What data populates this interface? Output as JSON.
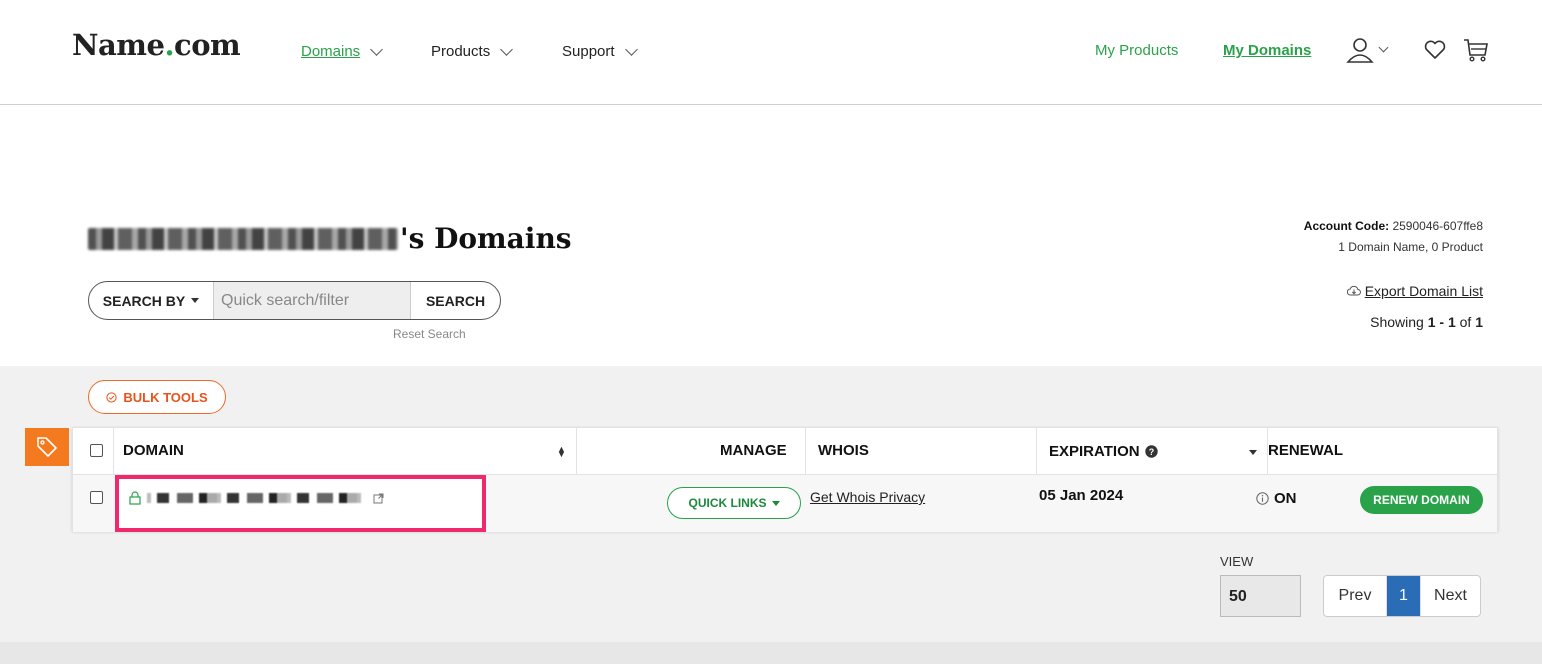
{
  "nav": {
    "logo_name": "Name",
    "logo_dot": ".",
    "logo_tld": "com",
    "items": [
      {
        "label": "Domains"
      },
      {
        "label": "Products"
      },
      {
        "label": "Support"
      }
    ],
    "my_products": "My Products",
    "my_domains": "My Domains",
    "icons": [
      "user-icon",
      "heart-icon",
      "cart-icon"
    ]
  },
  "header": {
    "title_suffix": "'s Domains",
    "account_code_label": "Account Code:",
    "account_code_value": " 2590046-607ffe8",
    "account_summary": "1 Domain Name, 0 Product",
    "export_label": "Export Domain List",
    "showing_prefix": "Showing ",
    "showing_range": "1 - 1",
    "showing_of": " of ",
    "showing_total": "1"
  },
  "search": {
    "search_by_label": "SEARCH BY",
    "placeholder": "Quick search/filter",
    "button_label": "SEARCH",
    "reset_label": "Reset Search"
  },
  "bulk_tools_label": "BULK TOOLS",
  "table": {
    "columns": {
      "domain": "DOMAIN",
      "manage": "MANAGE",
      "whois": "WHOIS",
      "expiration": "EXPIRATION",
      "renewal": "RENEWAL"
    },
    "rows": [
      {
        "quick_links": "QUICK LINKS",
        "whois_link": "Get Whois Privacy",
        "expiration": "05 Jan 2024",
        "renewal_status": "ON",
        "renew_button": "RENEW DOMAIN"
      }
    ]
  },
  "pagination": {
    "view_label": "VIEW",
    "view_value": "50",
    "prev": "Prev",
    "current": "1",
    "next": "Next"
  },
  "colors": {
    "brand_green": "#2aa24a",
    "accent_orange": "#f47a20",
    "highlight_pink": "#f0296d",
    "pager_blue": "#2a6cb5"
  }
}
